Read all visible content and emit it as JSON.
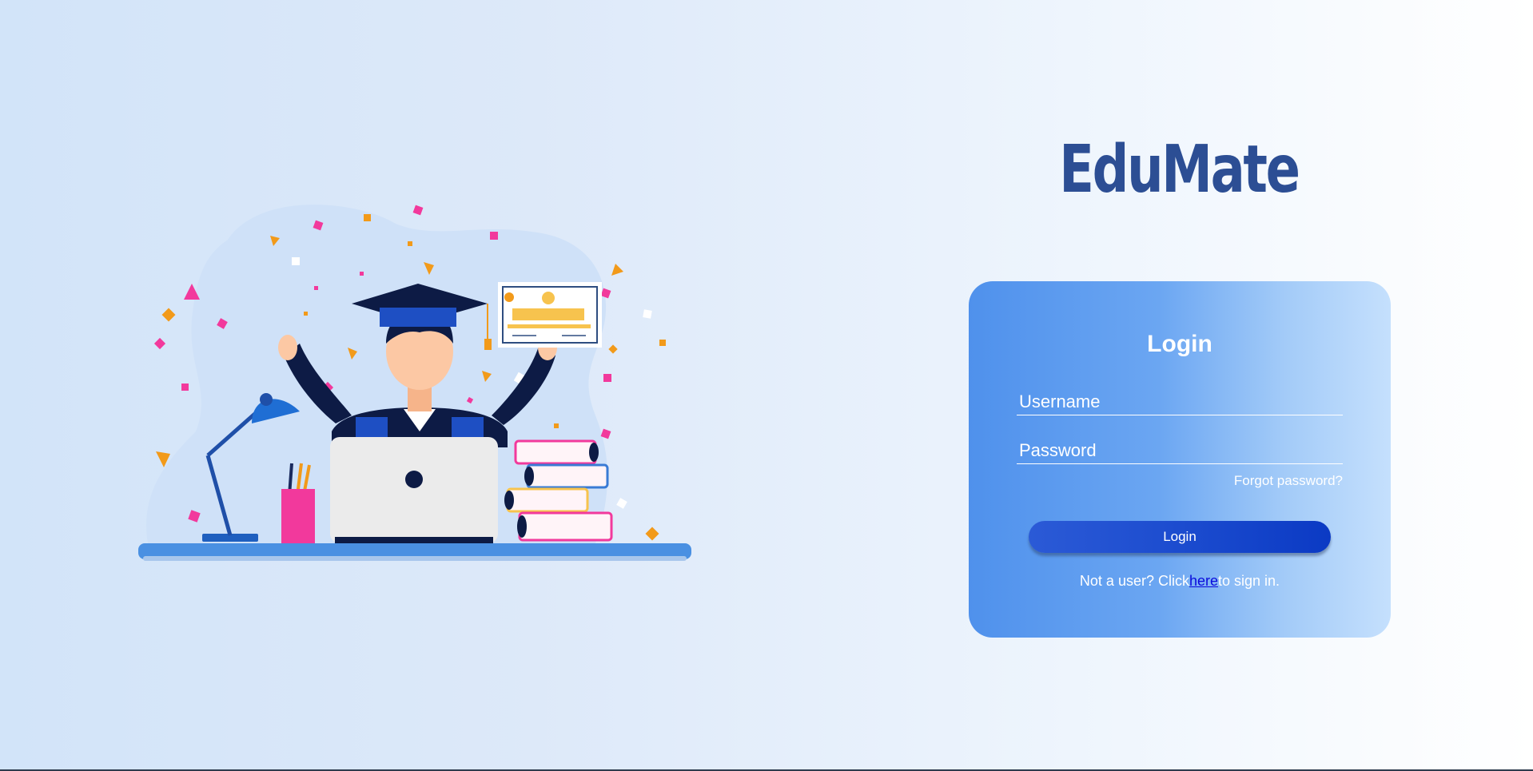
{
  "app": {
    "brand": "EduMate"
  },
  "illustration": {
    "subject": "graduate celebrating at desk with laptop, books, lamp and certificate"
  },
  "login_card": {
    "title": "Login",
    "username_placeholder": "Username",
    "password_placeholder": "Password",
    "forgot_password": "Forgot password?",
    "login_button": "Login",
    "signup_prefix": "Not a user? Click",
    "signup_link": "here",
    "signup_suffix": "to sign in."
  },
  "colors": {
    "brand": "#2c4e94",
    "card_start": "#4f91ec",
    "card_end": "#c5e0fd",
    "button": "#1c4ccf",
    "link": "#0a0adc"
  },
  "icons": [
    "graduation-cap-icon",
    "laptop-icon",
    "desk-lamp-icon",
    "books-icon",
    "certificate-icon",
    "pencil-cup-icon"
  ]
}
